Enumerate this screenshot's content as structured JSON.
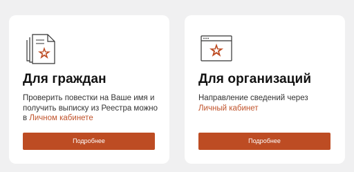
{
  "cards": [
    {
      "icon": "documents-star-icon",
      "title": "Для граждан",
      "desc_before": "Проверить повестки на Ваше имя и получить выписку из Реестра можно в ",
      "desc_link": "Личном кабинете",
      "desc_after": "",
      "button_label": "Подробнее"
    },
    {
      "icon": "browser-window-star-icon",
      "title": "Для организаций",
      "desc_before": "Направление сведений через ",
      "desc_link": "Личный кабинет",
      "desc_after": "",
      "button_label": "Подробнее"
    }
  ],
  "colors": {
    "accent": "#bd4c23",
    "link": "#c0532b",
    "background": "#f0f0f1",
    "card": "#ffffff"
  }
}
